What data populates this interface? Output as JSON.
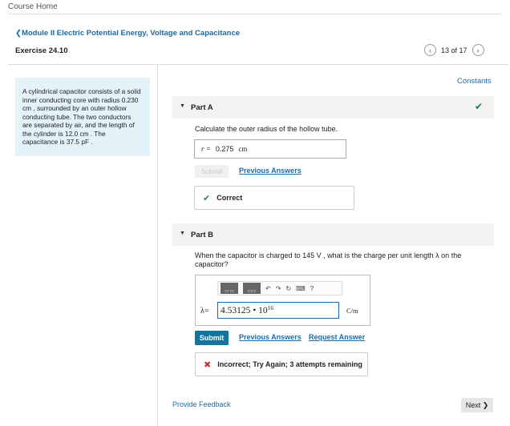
{
  "header": {
    "course_home": "Course Home",
    "module_title": "Module II Electric Potential Energy, Voltage and Capacitance",
    "module_chevron": "❮",
    "exercise": "Exercise 24.10",
    "pager": {
      "prev": "‹",
      "label": "13 of 17",
      "next": "›"
    }
  },
  "problem": {
    "text": "A cylindrical capacitor consists of a solid inner conducting core with radius 0.230 cm , surrounded by an outer hollow conducting tube. The two conductors are separated by air, and the length of the cylinder is 12.0 cm . The capacitance is 37.5 pF ."
  },
  "constants_link": "Constants",
  "part_a": {
    "title": "Part A",
    "prompt": "Calculate the outer radius of the hollow tube.",
    "answer_var": "r =",
    "answer_value": "0.275",
    "answer_unit": "cm",
    "submit": "Submit",
    "previous_answers": "Previous Answers",
    "status": "Correct",
    "status_icon": "check-icon"
  },
  "part_b": {
    "title": "Part B",
    "prompt": "When the capacitor is charged to 145 V , what is the charge per unit length λ on the capacitor?",
    "toolbar": {
      "undo": "↶",
      "redo": "↷",
      "reset": "↻",
      "keyboard": "⌨",
      "help": "?"
    },
    "lambda_label": "λ=",
    "input_value": "4.53125 • 10",
    "input_exponent": "16",
    "unit": "C/m",
    "submit": "Submit",
    "previous_answers": "Previous Answers",
    "request_answer": "Request Answer",
    "status": "Incorrect; Try Again; 3 attempts remaining",
    "status_icon": "x-icon"
  },
  "footer": {
    "provide_feedback": "Provide Feedback",
    "next": "Next"
  },
  "colors": {
    "link": "#1b6aa5",
    "submit": "#14749b",
    "correct": "#2f8a4a",
    "incorrect": "#c8323a",
    "problem_bg": "#e4f3f8"
  }
}
